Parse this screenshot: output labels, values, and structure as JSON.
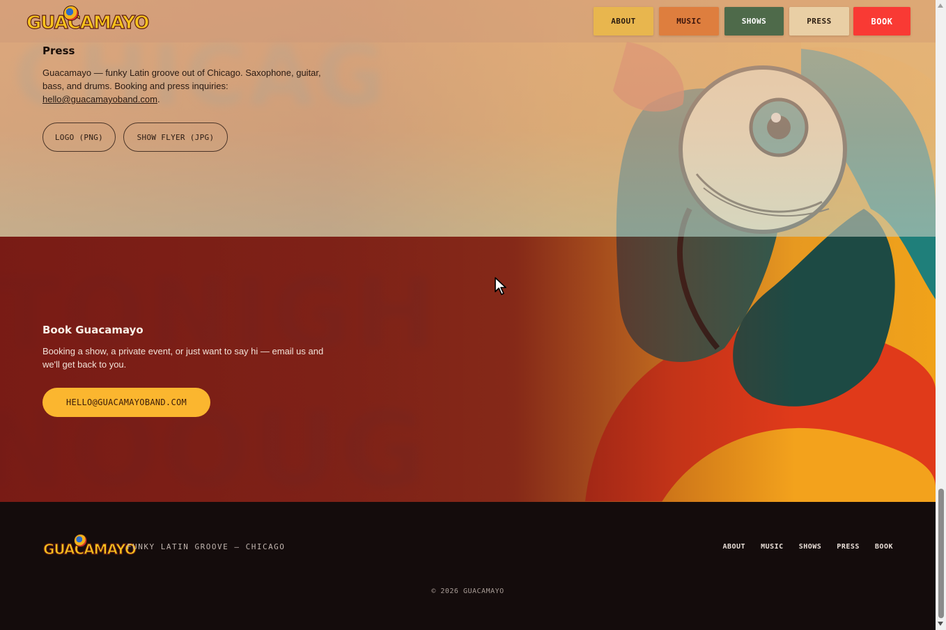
{
  "header": {
    "logo_text": "GUACAMAYO",
    "nav": {
      "about": "ABOUT",
      "music": "MUSIC",
      "shows": "SHOWS",
      "press": "PRESS",
      "book": "BOOK"
    }
  },
  "press": {
    "title": "Press",
    "body_text": "Guacamayo — funky Latin groove out of Chicago. Saxophone, guitar, bass, and drums. Booking and press inquiries: ",
    "email_link": "hello@guacamayoband.com",
    "body_end": ".",
    "logo_button": "LOGO (PNG)",
    "flyer_button": "SHOW FLYER (JPG)"
  },
  "book": {
    "title": "Book Guacamayo",
    "body": "Booking a show, a private event, or just want to say hi — email us and we'll get back to you.",
    "email_button": "HELLO@GUACAMAYOBAND.COM"
  },
  "footer": {
    "logo_text": "GUACAMAYO",
    "tagline": "FUNKY LATIN GROOVE — CHICAGO",
    "links": {
      "about": "ABOUT",
      "music": "MUSIC",
      "shows": "SHOWS",
      "press": "PRESS",
      "book": "BOOK"
    },
    "copyright": "© 2026 GUACAMAYO"
  },
  "colors": {
    "nav_about": "#e8b64e",
    "nav_music": "#de7e3e",
    "nav_shows": "#4e6a4a",
    "nav_press": "#e9cfa5",
    "nav_book": "#f93a34",
    "book_section_bg": "#731412",
    "email_button": "#fbb62f",
    "footer_bg": "#140c0c"
  }
}
